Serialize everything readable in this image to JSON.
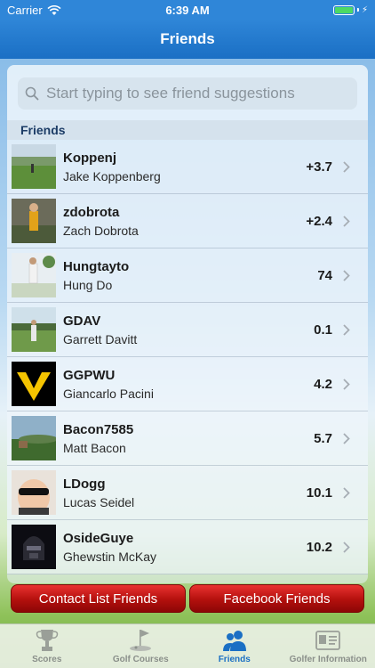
{
  "status_bar": {
    "carrier": "Carrier",
    "time": "6:39 AM"
  },
  "nav": {
    "title": "Friends"
  },
  "search": {
    "placeholder": "Start typing to see friend suggestions"
  },
  "section": {
    "title": "Friends"
  },
  "friends": [
    {
      "username": "Koppenj",
      "name": "Jake Koppenberg",
      "handicap": "+3.7"
    },
    {
      "username": "zdobrota",
      "name": "Zach Dobrota",
      "handicap": "+2.4"
    },
    {
      "username": "Hungtayto",
      "name": "Hung Do",
      "handicap": "74"
    },
    {
      "username": "GDAV",
      "name": "Garrett Davitt",
      "handicap": "0.1"
    },
    {
      "username": "GGPWU",
      "name": "Giancarlo Pacini",
      "handicap": "4.2"
    },
    {
      "username": "Bacon7585",
      "name": "Matt Bacon",
      "handicap": "5.7"
    },
    {
      "username": "LDogg",
      "name": "Lucas Seidel",
      "handicap": "10.1"
    },
    {
      "username": "OsideGuye",
      "name": "Ghewstin McKay",
      "handicap": "10.2"
    }
  ],
  "buttons": {
    "contact": "Contact List Friends",
    "facebook": "Facebook Friends"
  },
  "tabs": [
    {
      "label": "Scores",
      "icon": "trophy-icon"
    },
    {
      "label": "Golf Courses",
      "icon": "golf-flag-icon"
    },
    {
      "label": "Friends",
      "icon": "friends-icon"
    },
    {
      "label": "Golfer Information",
      "icon": "id-card-icon"
    }
  ],
  "colors": {
    "accent": "#1a6fc4",
    "button_red": "#c0140f",
    "battery": "#4cd964"
  }
}
